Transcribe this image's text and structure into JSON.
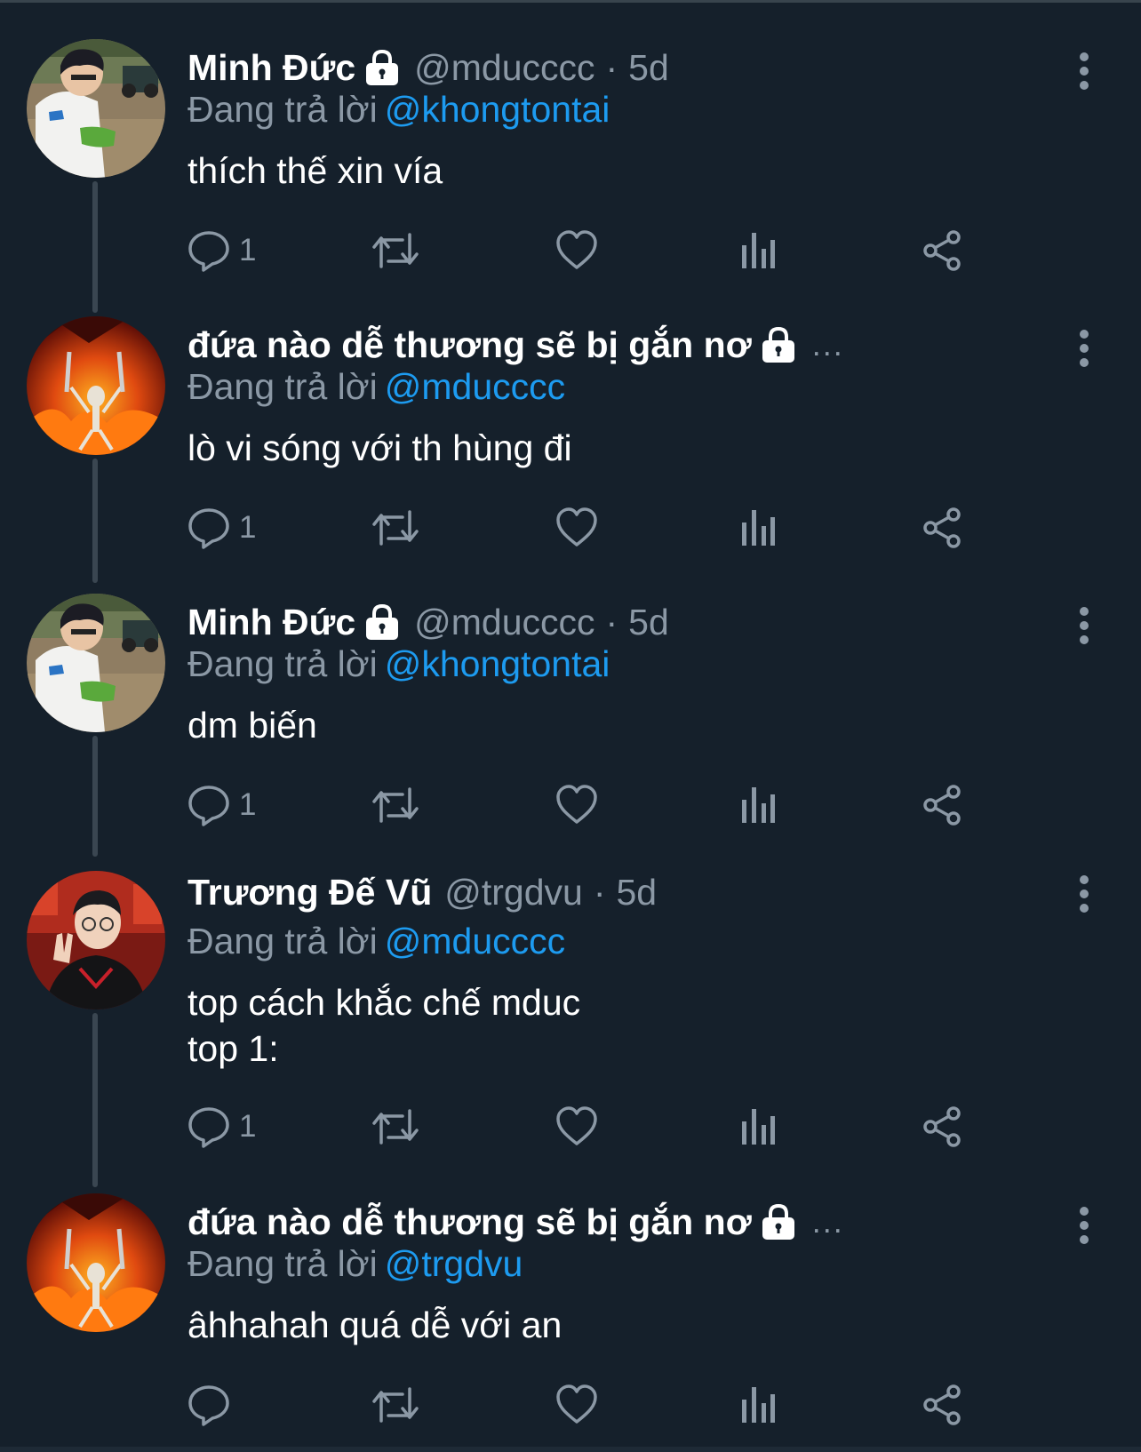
{
  "colors": {
    "background": "#15202b",
    "text_primary": "#ffffff",
    "text_secondary": "#8b98a5",
    "link": "#1d9bf0",
    "thread_line": "#3a4651"
  },
  "reply_prefix": "Đang trả lời",
  "tweets": [
    {
      "name": "Minh Đức",
      "locked": true,
      "handle": "@mducccc",
      "dot": "·",
      "time": "5d",
      "reply_to": "@khongtontai",
      "text": "thích thế xin vía",
      "reply_count": "1",
      "avatar": "photo-boy-field"
    },
    {
      "name": "đứa nào dễ thương sẽ bị gắn nơ",
      "locked": true,
      "ellipsis": "...",
      "reply_to": "@mducccc",
      "text": "lò vi sóng với th hùng đi",
      "reply_count": "1",
      "avatar": "skeleton-fire"
    },
    {
      "name": "Minh Đức",
      "locked": true,
      "handle": "@mducccc",
      "dot": "·",
      "time": "5d",
      "reply_to": "@khongtontai",
      "text": "dm biến",
      "reply_count": "1",
      "avatar": "photo-boy-field"
    },
    {
      "name": "Trương Đế Vũ",
      "locked": false,
      "handle": "@trgdvu",
      "dot": "·",
      "time": "5d",
      "reply_to": "@mducccc",
      "text": "top cách khắc chế mduc\ntop 1:",
      "reply_count": "1",
      "avatar": "photo-boy-red"
    },
    {
      "name": "đứa nào dễ thương sẽ bị gắn nơ",
      "locked": true,
      "ellipsis": "...",
      "reply_to": "@trgdvu",
      "text": "âhhahah quá dễ với an",
      "reply_count": "",
      "avatar": "skeleton-fire"
    }
  ]
}
